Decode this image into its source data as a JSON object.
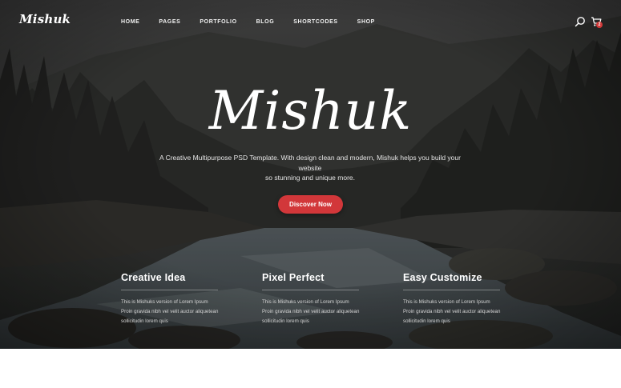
{
  "logo": "Mishuk",
  "nav": {
    "items": [
      "HOME",
      "PAGES",
      "PORTFOLIO",
      "BLOG",
      "SHORTCODES",
      "SHOP"
    ],
    "cart_count": "2"
  },
  "hero": {
    "title": "Mishuk",
    "tagline_line1": "A Creative Multipurpose PSD Template. With design clean and modern, Mishuk helps you build your website",
    "tagline_line2": "so stunning and unique more.",
    "cta_label": "Discover Now"
  },
  "features": [
    {
      "title": "Creative Idea",
      "text_line1": "This is Mishuks version  of Lorem Ipsum",
      "text_line2": "Proin gravida nibh vel velit auctor aliquetean",
      "text_line3": "sollicitudin  lorem quis"
    },
    {
      "title": "Pixel Perfect",
      "text_line1": "This is Mishuks version  of Lorem Ipsum",
      "text_line2": "Proin gravida nibh vel velit auctor aliquetean",
      "text_line3": "sollicitudin  lorem quis"
    },
    {
      "title": "Easy Customize",
      "text_line1": "This is Mishuks version  of Lorem Ipsum",
      "text_line2": "Proin gravida nibh vel velit auctor aliquetean",
      "text_line3": "sollicitudin  lorem quis"
    }
  ],
  "colors": {
    "accent": "#d2373a",
    "overlay": "#2a2b2a"
  },
  "icons": [
    "search-icon",
    "cart-icon"
  ]
}
